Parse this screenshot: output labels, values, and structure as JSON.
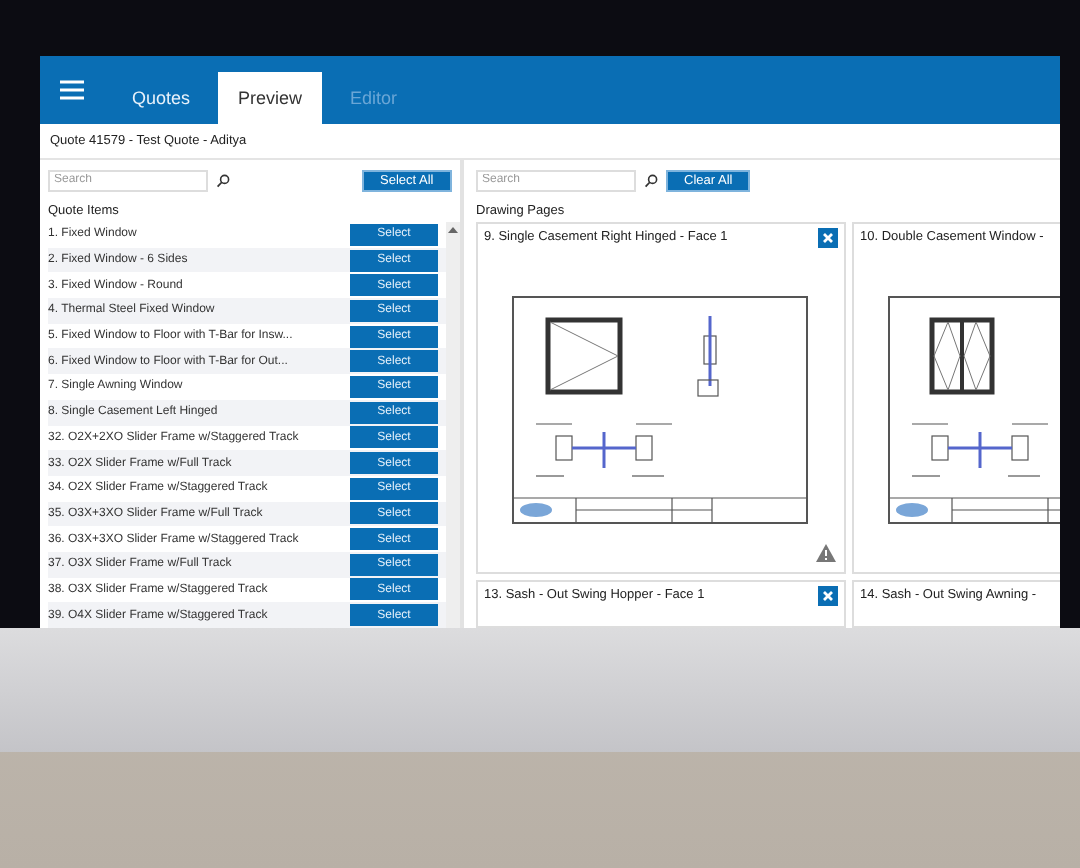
{
  "tabs": [
    {
      "label": "Quotes",
      "selected": false,
      "disabled": false
    },
    {
      "label": "Preview",
      "selected": true,
      "disabled": false
    },
    {
      "label": "Editor",
      "selected": false,
      "disabled": true
    }
  ],
  "quote_title": "Quote 41579 - Test Quote - Aditya",
  "quote_items": {
    "search_placeholder": "Search",
    "select_all": "Select All",
    "heading": "Quote Items",
    "rows": [
      {
        "name": "1. Fixed Window",
        "action": "Select"
      },
      {
        "name": "2. Fixed Window - 6 Sides",
        "action": "Select"
      },
      {
        "name": "3. Fixed Window - Round",
        "action": "Select"
      },
      {
        "name": "4. Thermal Steel Fixed Window",
        "action": "Select"
      },
      {
        "name": "5. Fixed Window to Floor with T-Bar for Insw...",
        "action": "Select"
      },
      {
        "name": "6. Fixed Window to Floor with T-Bar for Out...",
        "action": "Select"
      },
      {
        "name": "7. Single Awning Window",
        "action": "Select"
      },
      {
        "name": "8. Single Casement Left Hinged",
        "action": "Select"
      },
      {
        "name": "32. O2X+2XO Slider Frame w/Staggered Track",
        "action": "Select"
      },
      {
        "name": "33. O2X Slider Frame w/Full Track",
        "action": "Select"
      },
      {
        "name": "34. O2X Slider Frame w/Staggered Track",
        "action": "Select"
      },
      {
        "name": "35. O3X+3XO Slider Frame w/Full Track",
        "action": "Select"
      },
      {
        "name": "36. O3X+3XO Slider Frame w/Staggered Track",
        "action": "Select"
      },
      {
        "name": "37. O3X Slider Frame w/Full Track",
        "action": "Select"
      },
      {
        "name": "38. O3X Slider Frame w/Staggered Track",
        "action": "Select"
      },
      {
        "name": "39. O4X Slider Frame w/Staggered Track",
        "action": "Select"
      }
    ]
  },
  "drawing_pages": {
    "search_placeholder": "Search",
    "clear_all": "Clear All",
    "heading": "Drawing Pages",
    "cards": [
      {
        "title": "9. Single Casement Right Hinged -  Face 1",
        "closable": true,
        "warning": true,
        "kind": "single"
      },
      {
        "title": "10. Double Casement Window -",
        "closable": false,
        "warning": false,
        "kind": "double"
      },
      {
        "title": "13. Sash - Out Swing Hopper -  Face 1",
        "closable": true,
        "warning": false
      },
      {
        "title": "14. Sash - Out Swing Awning -",
        "closable": false,
        "warning": false
      }
    ]
  }
}
